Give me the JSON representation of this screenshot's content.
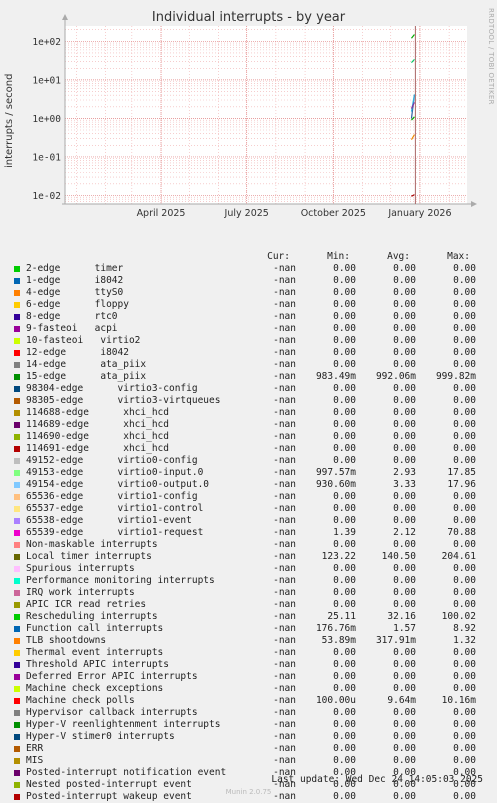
{
  "chart_data": {
    "type": "line",
    "title": "Individual interrupts - by year",
    "ylabel": "interrupts / second",
    "yscale": "log",
    "ylim": [
      0.006,
      250
    ],
    "yticks": [
      {
        "v": 0.01,
        "label": "1e-02"
      },
      {
        "v": 0.1,
        "label": "1e-01"
      },
      {
        "v": 1,
        "label": "1e+00"
      },
      {
        "v": 10,
        "label": "1e+01"
      },
      {
        "v": 100,
        "label": "1e+02"
      }
    ],
    "xlim": [
      "2024-12-20",
      "2026-02-20"
    ],
    "xticks": [
      {
        "date": "2025-04-01",
        "label": "April 2025"
      },
      {
        "date": "2025-07-01",
        "label": "July 2025"
      },
      {
        "date": "2025-10-01",
        "label": "October 2025"
      },
      {
        "date": "2026-01-01",
        "label": "January 2026"
      }
    ],
    "grid": true,
    "now_date": "2025-12-24",
    "marks": [
      {
        "color": "#3060a0",
        "date": "2025-12-23",
        "y0": 1.0,
        "y1": 4.0
      },
      {
        "color": "#30b0e0",
        "date": "2025-12-23",
        "y0": 1.5,
        "y1": 4.2
      },
      {
        "color": "#00aa00",
        "date": "2025-12-23",
        "y0": 0.9,
        "y1": 1.1
      },
      {
        "color": "#8030a0",
        "date": "2025-12-23",
        "y0": 1.8,
        "y1": 2.6
      },
      {
        "color": "#00aa00",
        "date": "2025-12-23",
        "y0": 120,
        "y1": 150
      },
      {
        "color": "#00cc66",
        "date": "2025-12-23",
        "y0": 28,
        "y1": 34
      },
      {
        "color": "#ee8800",
        "date": "2025-12-23",
        "y0": 0.28,
        "y1": 0.38
      },
      {
        "color": "#aa0000",
        "date": "2025-12-23",
        "y0": 0.0095,
        "y1": 0.0105
      }
    ]
  },
  "side_label": "RRDTOOL / TOBI OETIKER",
  "legend_header": {
    "cur": "Cur:",
    "min": "Min:",
    "avg": "Avg:",
    "max": "Max:"
  },
  "legend": [
    {
      "color": "#00cc00",
      "label": "2-edge      timer",
      "cur": "-nan",
      "min": "0.00",
      "avg": "0.00",
      "max": "0.00"
    },
    {
      "color": "#0066b3",
      "label": "1-edge      i8042",
      "cur": "-nan",
      "min": "0.00",
      "avg": "0.00",
      "max": "0.00"
    },
    {
      "color": "#ff8000",
      "label": "4-edge      ttyS0",
      "cur": "-nan",
      "min": "0.00",
      "avg": "0.00",
      "max": "0.00"
    },
    {
      "color": "#ffcc00",
      "label": "6-edge      floppy",
      "cur": "-nan",
      "min": "0.00",
      "avg": "0.00",
      "max": "0.00"
    },
    {
      "color": "#330099",
      "label": "8-edge      rtc0",
      "cur": "-nan",
      "min": "0.00",
      "avg": "0.00",
      "max": "0.00"
    },
    {
      "color": "#990099",
      "label": "9-fasteoi   acpi",
      "cur": "-nan",
      "min": "0.00",
      "avg": "0.00",
      "max": "0.00"
    },
    {
      "color": "#ccff00",
      "label": "10-fasteoi   virtio2",
      "cur": "-nan",
      "min": "0.00",
      "avg": "0.00",
      "max": "0.00"
    },
    {
      "color": "#ff0000",
      "label": "12-edge      i8042",
      "cur": "-nan",
      "min": "0.00",
      "avg": "0.00",
      "max": "0.00"
    },
    {
      "color": "#808080",
      "label": "14-edge      ata_piix",
      "cur": "-nan",
      "min": "0.00",
      "avg": "0.00",
      "max": "0.00"
    },
    {
      "color": "#008f00",
      "label": "15-edge      ata_piix",
      "cur": "-nan",
      "min": "983.49m",
      "avg": "992.06m",
      "max": "999.82m"
    },
    {
      "color": "#00487d",
      "label": "98304-edge      virtio3-config",
      "cur": "-nan",
      "min": "0.00",
      "avg": "0.00",
      "max": "0.00"
    },
    {
      "color": "#b35a00",
      "label": "98305-edge      virtio3-virtqueues",
      "cur": "-nan",
      "min": "0.00",
      "avg": "0.00",
      "max": "0.00"
    },
    {
      "color": "#b38f00",
      "label": "114688-edge      xhci_hcd",
      "cur": "-nan",
      "min": "0.00",
      "avg": "0.00",
      "max": "0.00"
    },
    {
      "color": "#6b006b",
      "label": "114689-edge      xhci_hcd",
      "cur": "-nan",
      "min": "0.00",
      "avg": "0.00",
      "max": "0.00"
    },
    {
      "color": "#8fb300",
      "label": "114690-edge      xhci_hcd",
      "cur": "-nan",
      "min": "0.00",
      "avg": "0.00",
      "max": "0.00"
    },
    {
      "color": "#b30000",
      "label": "114691-edge      xhci_hcd",
      "cur": "-nan",
      "min": "0.00",
      "avg": "0.00",
      "max": "0.00"
    },
    {
      "color": "#bebebe",
      "label": "49152-edge      virtio0-config",
      "cur": "-nan",
      "min": "0.00",
      "avg": "0.00",
      "max": "0.00"
    },
    {
      "color": "#80ff80",
      "label": "49153-edge      virtio0-input.0",
      "cur": "-nan",
      "min": "997.57m",
      "avg": "2.93",
      "max": "17.85"
    },
    {
      "color": "#80c9ff",
      "label": "49154-edge      virtio0-output.0",
      "cur": "-nan",
      "min": "930.60m",
      "avg": "3.33",
      "max": "17.96"
    },
    {
      "color": "#ffc080",
      "label": "65536-edge      virtio1-config",
      "cur": "-nan",
      "min": "0.00",
      "avg": "0.00",
      "max": "0.00"
    },
    {
      "color": "#ffe680",
      "label": "65537-edge      virtio1-control",
      "cur": "-nan",
      "min": "0.00",
      "avg": "0.00",
      "max": "0.00"
    },
    {
      "color": "#aa80ff",
      "label": "65538-edge      virtio1-event",
      "cur": "-nan",
      "min": "0.00",
      "avg": "0.00",
      "max": "0.00"
    },
    {
      "color": "#ee00cc",
      "label": "65539-edge      virtio1-request",
      "cur": "-nan",
      "min": "1.39",
      "avg": "2.12",
      "max": "70.88"
    },
    {
      "color": "#ff8080",
      "label": "Non-maskable interrupts",
      "cur": "-nan",
      "min": "0.00",
      "avg": "0.00",
      "max": "0.00"
    },
    {
      "color": "#666600",
      "label": "Local timer interrupts",
      "cur": "-nan",
      "min": "123.22",
      "avg": "140.50",
      "max": "204.61"
    },
    {
      "color": "#ffbfff",
      "label": "Spurious interrupts",
      "cur": "-nan",
      "min": "0.00",
      "avg": "0.00",
      "max": "0.00"
    },
    {
      "color": "#00ffcc",
      "label": "Performance monitoring interrupts",
      "cur": "-nan",
      "min": "0.00",
      "avg": "0.00",
      "max": "0.00"
    },
    {
      "color": "#cc6699",
      "label": "IRQ work interrupts",
      "cur": "-nan",
      "min": "0.00",
      "avg": "0.00",
      "max": "0.00"
    },
    {
      "color": "#999900",
      "label": "APIC ICR read retries",
      "cur": "-nan",
      "min": "0.00",
      "avg": "0.00",
      "max": "0.00"
    },
    {
      "color": "#00cc00",
      "label": "Rescheduling interrupts",
      "cur": "-nan",
      "min": "25.11",
      "avg": "32.16",
      "max": "100.02"
    },
    {
      "color": "#0066b3",
      "label": "Function call interrupts",
      "cur": "-nan",
      "min": "176.76m",
      "avg": "1.57",
      "max": "8.92"
    },
    {
      "color": "#ff8000",
      "label": "TLB shootdowns",
      "cur": "-nan",
      "min": "53.89m",
      "avg": "317.91m",
      "max": "1.32"
    },
    {
      "color": "#ffcc00",
      "label": "Thermal event interrupts",
      "cur": "-nan",
      "min": "0.00",
      "avg": "0.00",
      "max": "0.00"
    },
    {
      "color": "#330099",
      "label": "Threshold APIC interrupts",
      "cur": "-nan",
      "min": "0.00",
      "avg": "0.00",
      "max": "0.00"
    },
    {
      "color": "#990099",
      "label": "Deferred Error APIC interrupts",
      "cur": "-nan",
      "min": "0.00",
      "avg": "0.00",
      "max": "0.00"
    },
    {
      "color": "#ccff00",
      "label": "Machine check exceptions",
      "cur": "-nan",
      "min": "0.00",
      "avg": "0.00",
      "max": "0.00"
    },
    {
      "color": "#ff0000",
      "label": "Machine check polls",
      "cur": "-nan",
      "min": "100.00u",
      "avg": "9.64m",
      "max": "10.16m"
    },
    {
      "color": "#808080",
      "label": "Hypervisor callback interrupts",
      "cur": "-nan",
      "min": "0.00",
      "avg": "0.00",
      "max": "0.00"
    },
    {
      "color": "#008f00",
      "label": "Hyper-V reenlightenment interrupts",
      "cur": "-nan",
      "min": "0.00",
      "avg": "0.00",
      "max": "0.00"
    },
    {
      "color": "#00487d",
      "label": "Hyper-V stimer0 interrupts",
      "cur": "-nan",
      "min": "0.00",
      "avg": "0.00",
      "max": "0.00"
    },
    {
      "color": "#b35a00",
      "label": "ERR",
      "cur": "-nan",
      "min": "0.00",
      "avg": "0.00",
      "max": "0.00"
    },
    {
      "color": "#b38f00",
      "label": "MIS",
      "cur": "-nan",
      "min": "0.00",
      "avg": "0.00",
      "max": "0.00"
    },
    {
      "color": "#6b006b",
      "label": "Posted-interrupt notification event",
      "cur": "-nan",
      "min": "0.00",
      "avg": "0.00",
      "max": "0.00"
    },
    {
      "color": "#8fb300",
      "label": "Nested posted-interrupt event",
      "cur": "-nan",
      "min": "0.00",
      "avg": "0.00",
      "max": "0.00"
    },
    {
      "color": "#b30000",
      "label": "Posted-interrupt wakeup event",
      "cur": "-nan",
      "min": "0.00",
      "avg": "0.00",
      "max": "0.00"
    }
  ],
  "footer": {
    "last_update": "Last update: Wed Dec 24 14:05:03 2025",
    "version": "Munin 2.0.75"
  }
}
